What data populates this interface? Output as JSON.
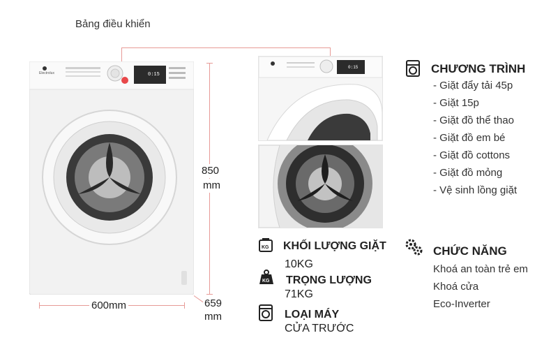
{
  "panel_label": "Bảng điều khiển",
  "dimensions": {
    "height": "850",
    "height_unit": "mm",
    "width": "600mm",
    "depth": "659",
    "depth_unit": "mm"
  },
  "weight_capacity": {
    "label": "KHỐI LƯỢNG GIẶT",
    "value": "10KG"
  },
  "weight": {
    "label": "TRỌNG LƯỢNG",
    "value": "71KG",
    "icon_text": "KG"
  },
  "machine_type": {
    "label": "LOẠI MÁY",
    "value": "CỬA TRƯỚC"
  },
  "programs": {
    "title": "CHƯƠNG TRÌNH",
    "items": [
      "- Giặt đẩy tải 45p",
      "- Giặt 15p",
      "- Giặt đồ thể thao",
      "- Giặt đồ em bé",
      "- Giặt đồ cottons",
      "- Giặt đồ mỏng",
      "- Vệ sinh lồng giặt"
    ]
  },
  "features": {
    "title": "CHỨC NĂNG",
    "items": [
      "Khoá an toàn trẻ em",
      "Khoá cửa",
      "Eco-Inverter"
    ]
  },
  "display_readout": "0:15",
  "colors": {
    "accent_line": "#e79a96",
    "text": "#222222",
    "highlight_dot": "#e8484a"
  }
}
